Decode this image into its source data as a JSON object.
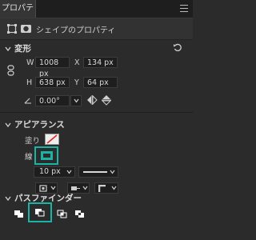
{
  "tab": {
    "label": "プロパティ"
  },
  "subheader": {
    "title": "シェイプのプロパティ"
  },
  "transform": {
    "title": "変形",
    "w_label": "W",
    "w_value": "1008 px",
    "x_label": "X",
    "x_value": "134 px",
    "h_label": "H",
    "h_value": "638 px",
    "y_label": "Y",
    "y_value": "64 px",
    "angle_value": "0.00°"
  },
  "appearance": {
    "title": "アピアランス",
    "fill_label": "塗り",
    "stroke_label": "線",
    "stroke_width": "10 px"
  },
  "pathfinder": {
    "title": "パスファインダー"
  },
  "colors": {
    "accent": "#19b4a6",
    "fill_none_slash": "#e02020"
  }
}
